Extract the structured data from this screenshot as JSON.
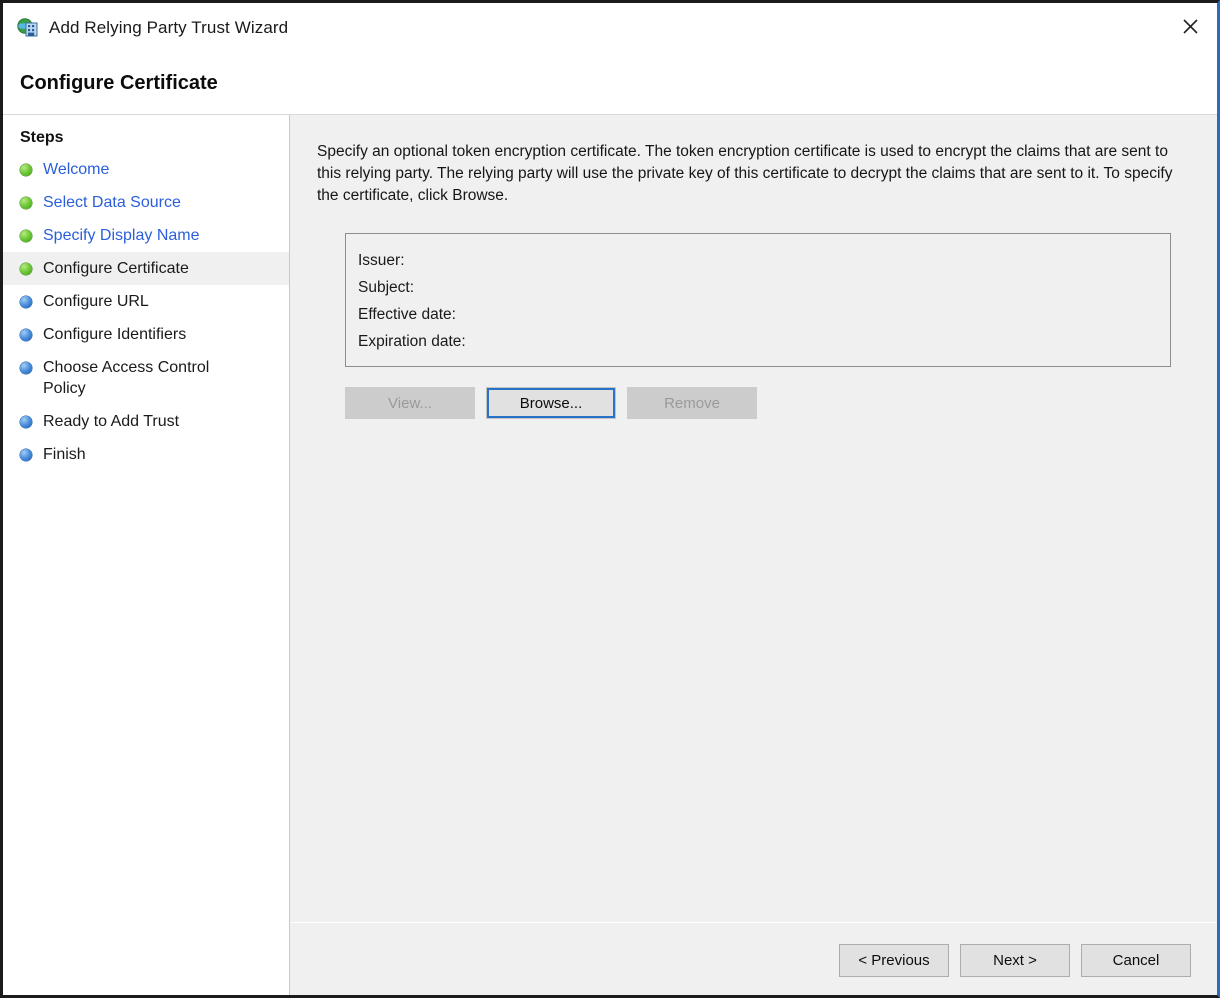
{
  "window": {
    "title": "Add Relying Party Trust Wizard",
    "icon": "relying-party-trust-icon",
    "close_label": "✕",
    "border_accent": "#2a6bbf"
  },
  "header": {
    "title": "Configure Certificate"
  },
  "sidebar": {
    "heading": "Steps",
    "items": [
      {
        "label": "Welcome",
        "state": "done",
        "bullet": "green"
      },
      {
        "label": "Select Data Source",
        "state": "done",
        "bullet": "green"
      },
      {
        "label": "Specify Display Name",
        "state": "done",
        "bullet": "green"
      },
      {
        "label": "Configure Certificate",
        "state": "current",
        "bullet": "green"
      },
      {
        "label": "Configure URL",
        "state": "pending",
        "bullet": "blue"
      },
      {
        "label": "Configure Identifiers",
        "state": "pending",
        "bullet": "blue"
      },
      {
        "label": "Choose Access Control Policy",
        "state": "pending",
        "bullet": "blue"
      },
      {
        "label": "Ready to Add Trust",
        "state": "pending",
        "bullet": "blue"
      },
      {
        "label": "Finish",
        "state": "pending",
        "bullet": "blue"
      }
    ]
  },
  "main": {
    "description": "Specify an optional token encryption certificate.  The token encryption certificate is used to encrypt the claims that are sent to this relying party.  The relying party will use the private key of this certificate to decrypt the claims that are sent to it.  To specify the certificate, click Browse.",
    "certificate": {
      "issuer_label": "Issuer:",
      "issuer_value": "",
      "subject_label": "Subject:",
      "subject_value": "",
      "effective_date_label": "Effective date:",
      "effective_date_value": "",
      "expiration_date_label": "Expiration date:",
      "expiration_date_value": ""
    },
    "buttons": {
      "view": "View...",
      "browse": "Browse...",
      "remove": "Remove"
    }
  },
  "footer": {
    "previous": "< Previous",
    "next": "Next >",
    "cancel": "Cancel"
  }
}
